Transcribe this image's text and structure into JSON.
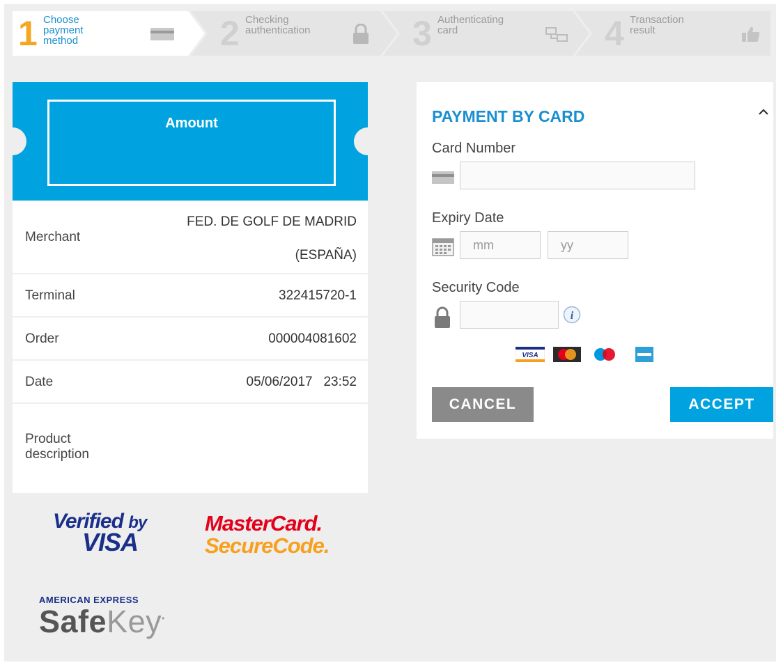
{
  "steps": [
    {
      "number": "1",
      "label_lines": [
        "Choose",
        "payment",
        "method"
      ],
      "icon": "card-icon",
      "active": true
    },
    {
      "number": "2",
      "label_lines": [
        "Checking",
        "authentication"
      ],
      "icon": "lock-icon",
      "active": false
    },
    {
      "number": "3",
      "label_lines": [
        "Authenticating",
        "card"
      ],
      "icon": "network-icon",
      "active": false
    },
    {
      "number": "4",
      "label_lines": [
        "Transaction",
        "result"
      ],
      "icon": "thumbs-up-icon",
      "active": false
    }
  ],
  "amount": {
    "label": "Amount"
  },
  "details": {
    "merchant": {
      "label": "Merchant",
      "value_line1": "FED. DE GOLF DE MADRID",
      "value_line2": "(ESPAÑA)"
    },
    "terminal": {
      "label": "Terminal",
      "value": "322415720-1"
    },
    "order": {
      "label": "Order",
      "value": "000004081602"
    },
    "date": {
      "label": "Date",
      "value": "05/06/2017   23:52"
    },
    "product": {
      "label_line1": "Product",
      "label_line2": "description",
      "value": ""
    }
  },
  "secure_logos": {
    "visa": {
      "line1": "Verified",
      "line1_by": "by",
      "line2": "VISA"
    },
    "mastercard": {
      "line1": "MasterCard.",
      "line2": "SecureCode."
    },
    "amex": {
      "line1": "AMERICAN EXPRESS",
      "line2_safe": "Safe",
      "line2_key": "Key"
    }
  },
  "payment": {
    "title": "PAYMENT BY CARD",
    "card_number": {
      "label": "Card Number",
      "value": ""
    },
    "expiry": {
      "label": "Expiry Date",
      "mm_placeholder": "mm",
      "yy_placeholder": "yy"
    },
    "security": {
      "label": "Security Code",
      "value": ""
    },
    "brands": [
      "VISA",
      "MasterCard",
      "Maestro",
      "American Express"
    ],
    "brand_visa_text": "VISA",
    "cancel_label": "CANCEL",
    "accept_label": "ACCEPT"
  },
  "colors": {
    "accent": "#00a3e0",
    "link_blue": "#1a8fd0",
    "step_active_number": "#f5a623",
    "cancel_gray": "#8a8a8a"
  }
}
